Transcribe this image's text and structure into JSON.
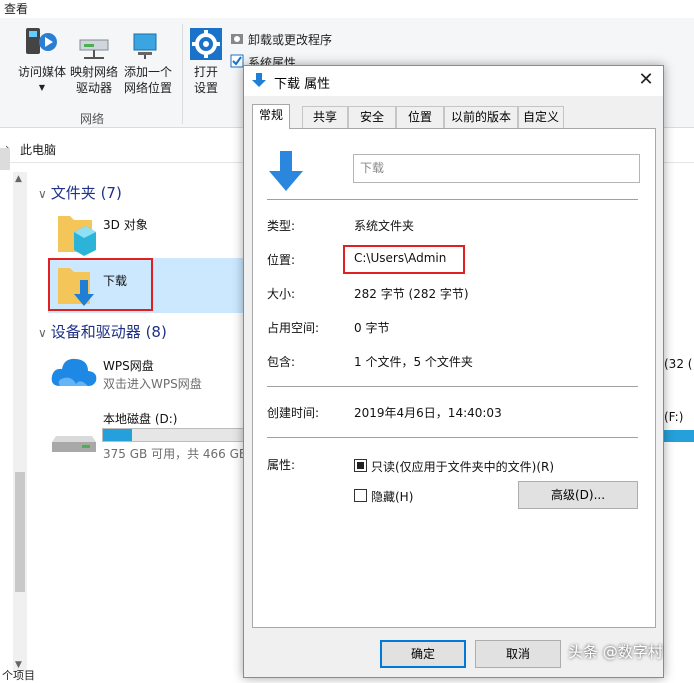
{
  "ribbon": {
    "tab_label": "查看",
    "btn_media": "访问媒体",
    "btn_map_drive_1": "映射网络",
    "btn_map_drive_2": "驱动器",
    "btn_add_location_1": "添加一个",
    "btn_add_location_2": "网络位置",
    "btn_open_settings_1": "打开",
    "btn_open_settings_2": "设置",
    "uninstall": "卸载或更改程序",
    "system_props": "系统属性",
    "group_network": "网络"
  },
  "address": {
    "text": "此电脑"
  },
  "folders": {
    "header": "文件夹 (7)",
    "item_3d": "3D 对象",
    "item_downloads": "下载"
  },
  "devices": {
    "header": "设备和驱动器 (8)",
    "wps_name": "WPS网盘",
    "wps_sub": "双击进入WPS网盘",
    "disk_d_name": "本地磁盘 (D:)",
    "disk_d_space": "375 GB 可用，共 466 GB",
    "disk_d_used_fraction": 0.2,
    "right_frag_1": "(32 (",
    "right_frag_2": "(F:)"
  },
  "status": {
    "text": "个项目"
  },
  "dialog": {
    "title": "下载 属性",
    "close": "✕",
    "tabs": [
      "常规",
      "共享",
      "安全",
      "位置",
      "以前的版本",
      "自定义"
    ],
    "name_value": "下载",
    "type_label": "类型:",
    "type_value": "系统文件夹",
    "location_label": "位置:",
    "location_value": "C:\\Users\\Admin",
    "size_label": "大小:",
    "size_value": "282 字节 (282 字节)",
    "disk_size_label": "占用空间:",
    "disk_size_value": "0 字节",
    "contains_label": "包含:",
    "contains_value": "1 个文件，5 个文件夹",
    "created_label": "创建时间:",
    "created_value": "2019年4月6日，14:40:03",
    "attrs_label": "属性:",
    "readonly_label": "只读(仅应用于文件夹中的文件)(R)",
    "hidden_label": "隐藏(H)",
    "advanced_button": "高级(D)...",
    "ok_button": "确定",
    "cancel_button": "取消"
  },
  "watermark": {
    "text": "头条 @数字村"
  },
  "colors": {
    "accent": "#0078d7",
    "highlight_box": "#e02020",
    "section_header": "#1e3287"
  }
}
